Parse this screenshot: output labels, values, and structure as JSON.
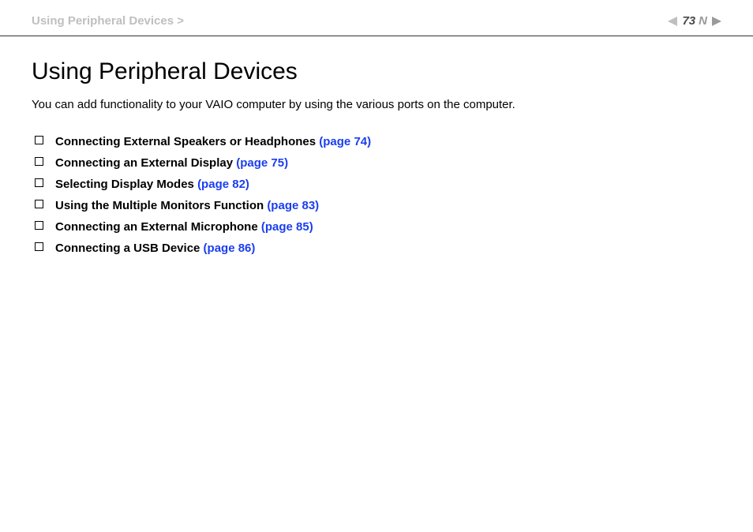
{
  "header": {
    "breadcrumb": "Using Peripheral Devices >",
    "page_number": "73",
    "n_letter": "N"
  },
  "main": {
    "title": "Using Peripheral Devices",
    "intro": "You can add functionality to your VAIO computer by using the various ports on the computer.",
    "toc": [
      {
        "label": "Connecting External Speakers or Headphones ",
        "ref": "(page 74)"
      },
      {
        "label": "Connecting an External Display ",
        "ref": "(page 75)"
      },
      {
        "label": "Selecting Display Modes ",
        "ref": "(page 82)"
      },
      {
        "label": "Using the Multiple Monitors Function ",
        "ref": "(page 83)"
      },
      {
        "label": "Connecting an External Microphone ",
        "ref": "(page 85)"
      },
      {
        "label": "Connecting a USB Device ",
        "ref": "(page 86)"
      }
    ]
  }
}
